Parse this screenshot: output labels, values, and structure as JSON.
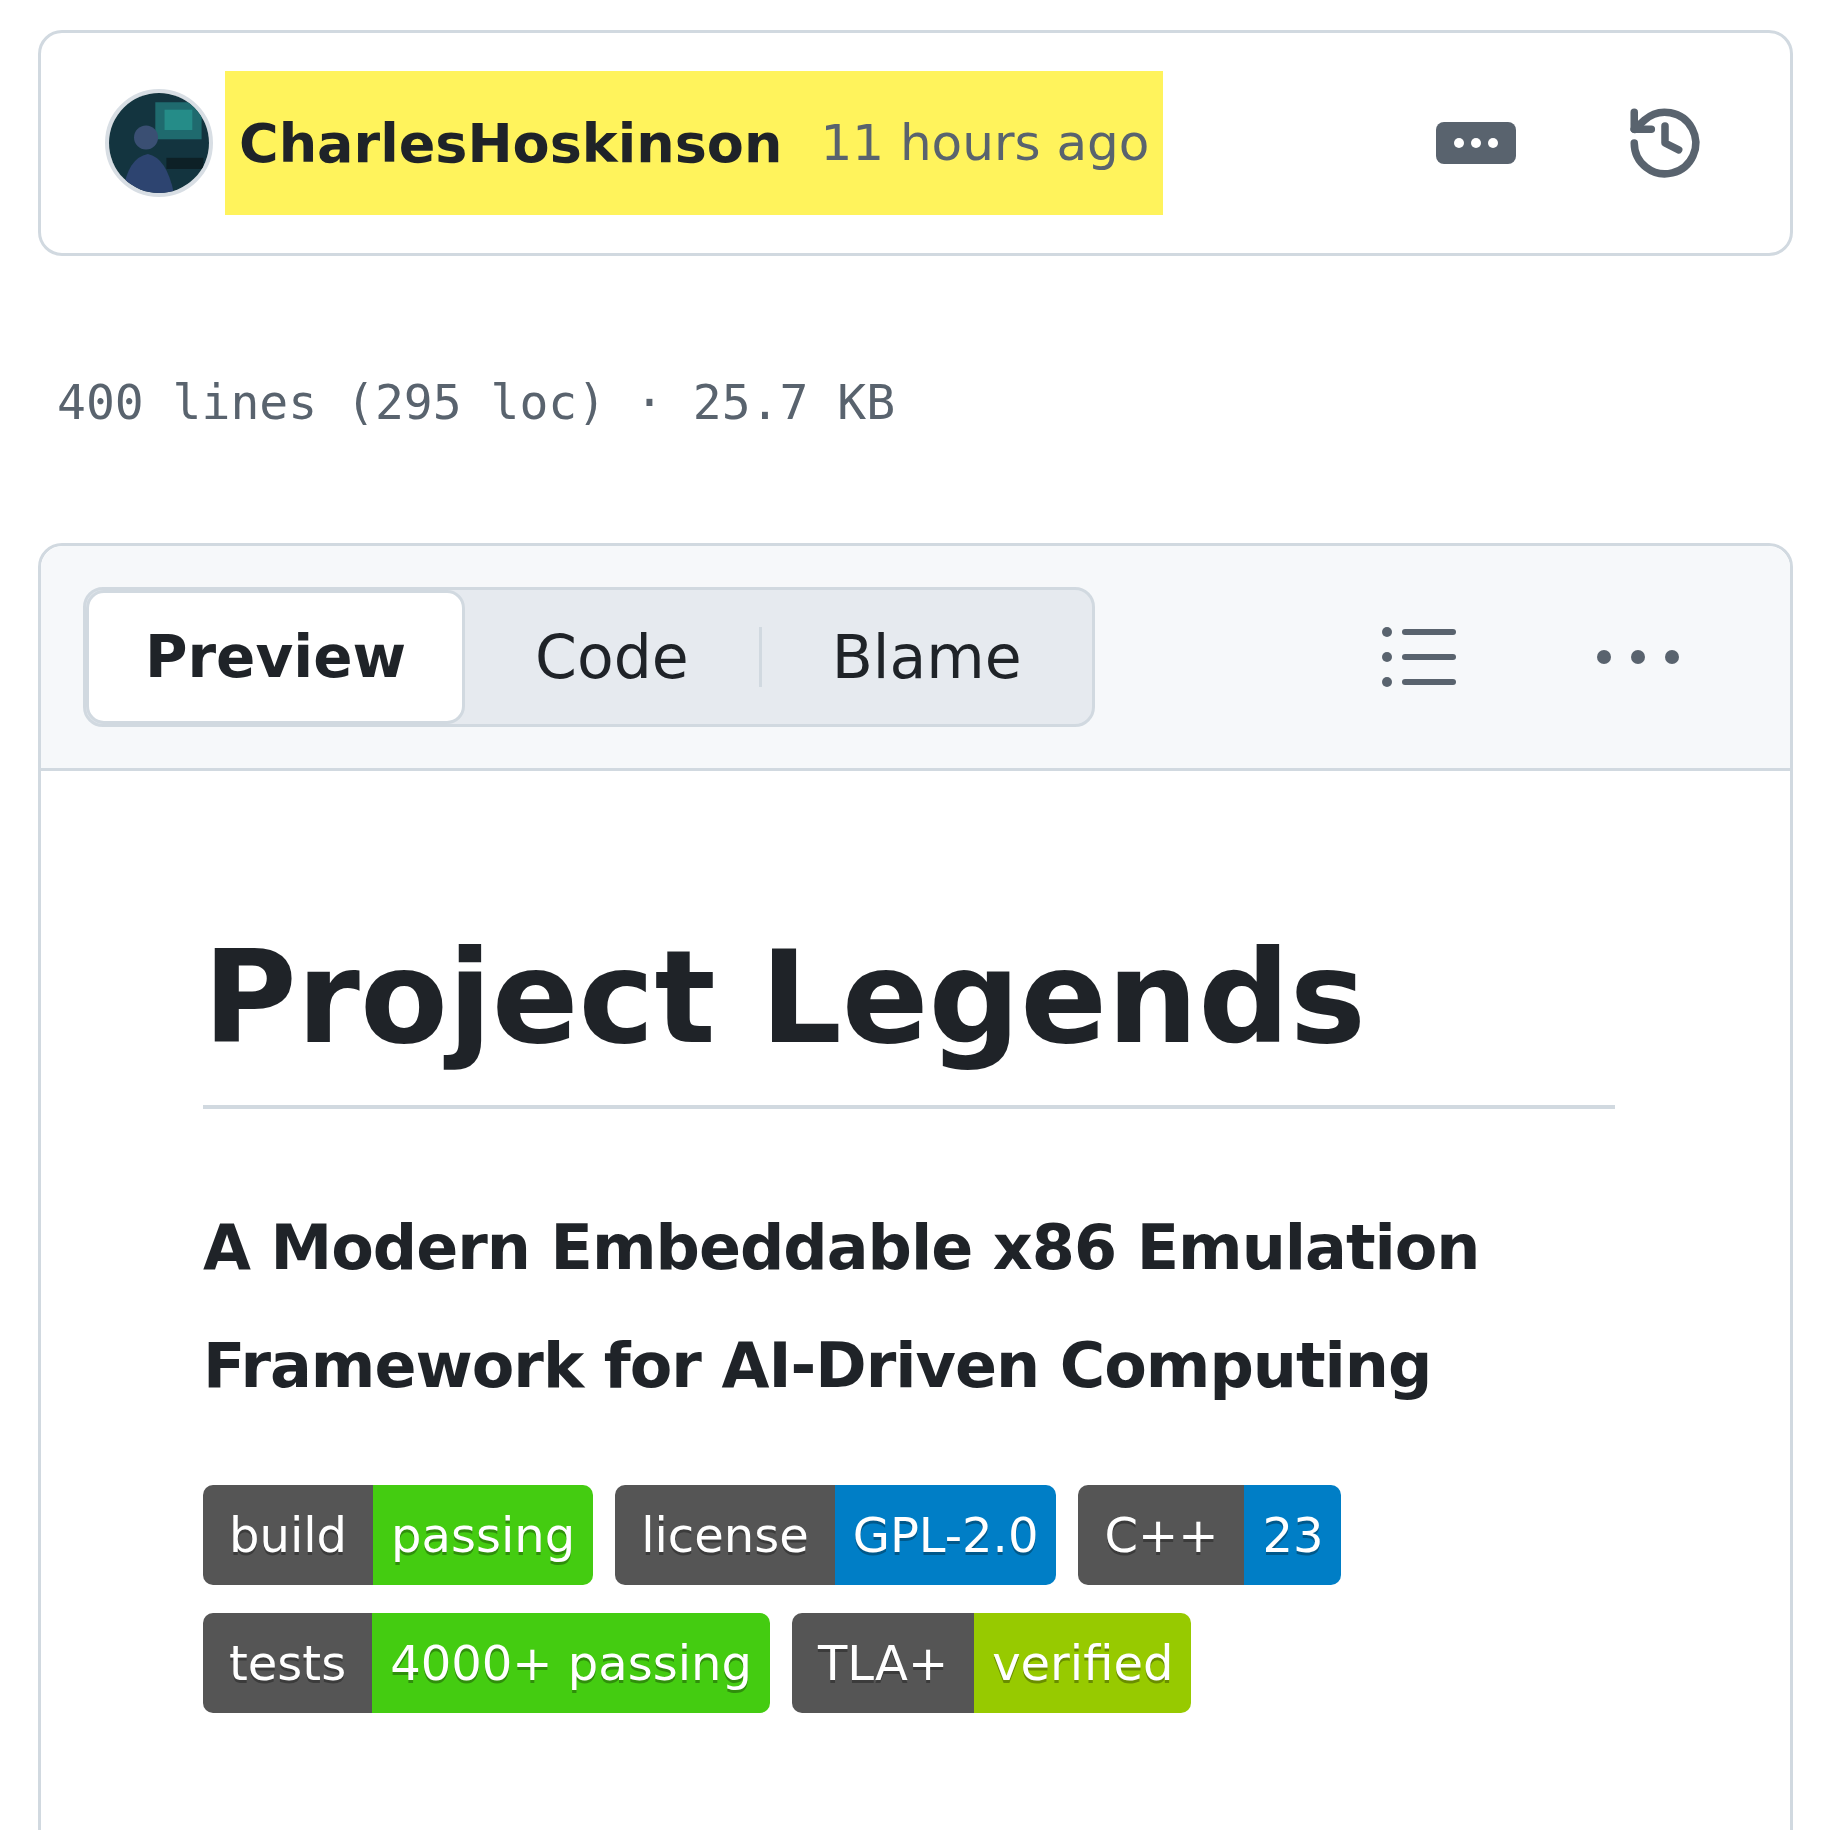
{
  "commit": {
    "author": "CharlesHoskinson",
    "time": "11 hours ago",
    "highlighted": true
  },
  "file_meta": "400 lines (295 loc) · 25.7 KB",
  "tabs": [
    {
      "label": "Preview",
      "selected": true
    },
    {
      "label": "Code",
      "selected": false
    },
    {
      "label": "Blame",
      "selected": false
    }
  ],
  "readme": {
    "title": "Project Legends",
    "subtitle": "A Modern Embeddable x86 Emulation Framework for AI-Driven Computing",
    "badges": [
      {
        "label": "build",
        "value": "passing",
        "color": "#4c1"
      },
      {
        "label": "license",
        "value": "GPL-2.0",
        "color": "#007ec6"
      },
      {
        "label": "C++",
        "value": "23",
        "color": "#007ec6"
      },
      {
        "label": "tests",
        "value": "4000+ passing",
        "color": "#4c1"
      },
      {
        "label": "TLA+",
        "value": "verified",
        "color": "#97ca00"
      }
    ]
  }
}
